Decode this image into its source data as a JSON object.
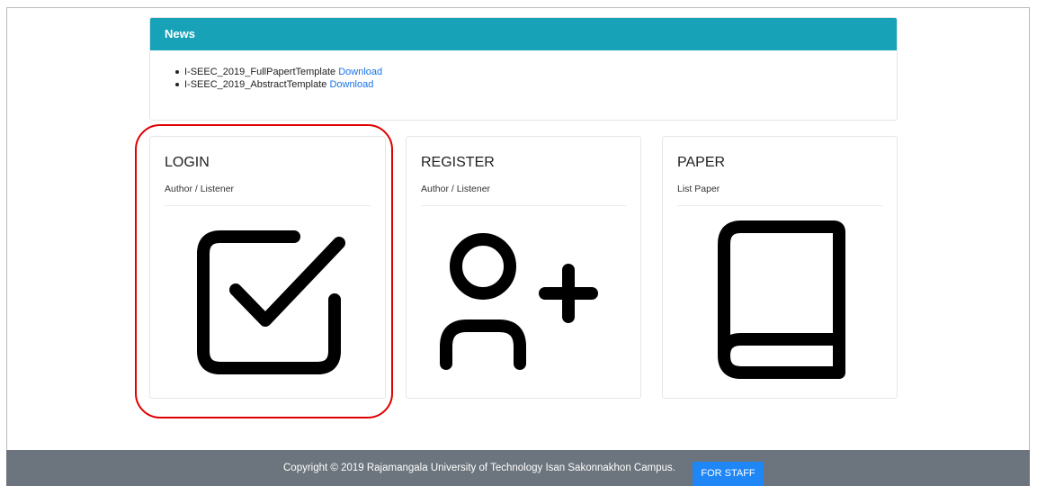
{
  "news": {
    "header": "News",
    "items": [
      {
        "text": "I-SEEC_2019_FullPapertTemplate",
        "link": "Download"
      },
      {
        "text": "I-SEEC_2019_AbstractTemplate",
        "link": "Download"
      }
    ]
  },
  "cards": [
    {
      "title": "LOGIN",
      "subtitle": "Author / Listener",
      "icon": "check-square-icon"
    },
    {
      "title": "REGISTER",
      "subtitle": "Author / Listener",
      "icon": "user-plus-icon"
    },
    {
      "title": "PAPER",
      "subtitle": "List Paper",
      "icon": "book-icon"
    }
  ],
  "footer": {
    "copyright": "Copyright © 2019 Rajamangala University of Technology Isan Sakonnakhon Campus.",
    "staff_button": "FOR STAFF"
  },
  "colors": {
    "news_header_bg": "#17a2b8",
    "link": "#1a73e8",
    "footer_bg": "#6c757d",
    "staff_button_bg": "#1f86f5",
    "highlight": "#e00000"
  }
}
